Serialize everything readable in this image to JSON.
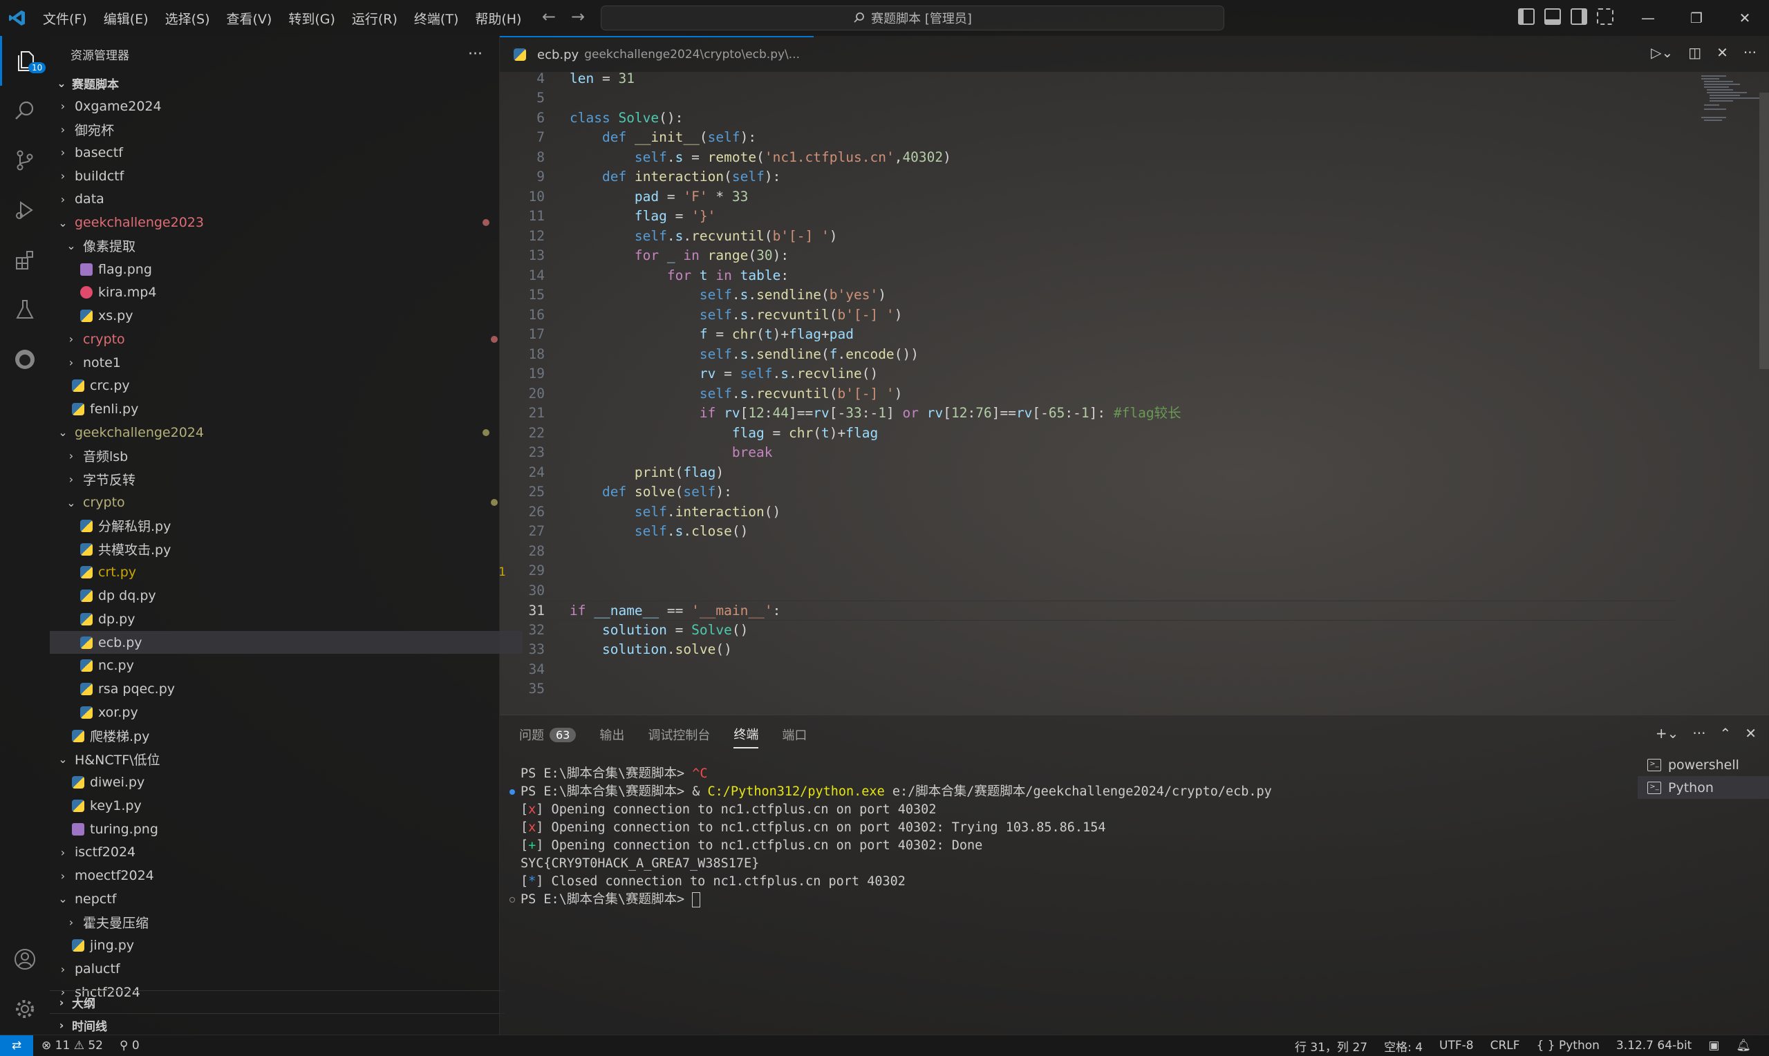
{
  "titlebar": {
    "menus": [
      "文件(F)",
      "编辑(E)",
      "选择(S)",
      "查看(V)",
      "转到(G)",
      "运行(R)",
      "终端(T)",
      "帮助(H)"
    ],
    "search_text": "赛题脚本 [管理员]"
  },
  "activity": {
    "explorer_badge": "10"
  },
  "sidebar": {
    "title": "资源管理器",
    "root": "赛题脚本",
    "outline": "大纲",
    "timeline": "时间线",
    "tree": [
      {
        "label": "0xgame2024"
      },
      {
        "label": "御宛杯"
      },
      {
        "label": "basectf"
      },
      {
        "label": "buildctf"
      },
      {
        "label": "data"
      },
      {
        "label": "geekchallenge2023"
      },
      {
        "label": "像素提取"
      },
      {
        "label": "flag.png"
      },
      {
        "label": "kira.mp4"
      },
      {
        "label": "xs.py"
      },
      {
        "label": "crypto"
      },
      {
        "label": "note1"
      },
      {
        "label": "crc.py"
      },
      {
        "label": "fenli.py"
      },
      {
        "label": "geekchallenge2024"
      },
      {
        "label": "音频lsb"
      },
      {
        "label": "字节反转"
      },
      {
        "label": "crypto"
      },
      {
        "label": "分解私钥.py"
      },
      {
        "label": "共模攻击.py"
      },
      {
        "label": "crt.py",
        "badge": "1"
      },
      {
        "label": "dp dq.py"
      },
      {
        "label": "dp.py"
      },
      {
        "label": "ecb.py"
      },
      {
        "label": "nc.py"
      },
      {
        "label": "rsa pqec.py"
      },
      {
        "label": "xor.py"
      },
      {
        "label": "爬楼梯.py"
      },
      {
        "label": "H&NCTF\\低位"
      },
      {
        "label": "diwei.py"
      },
      {
        "label": "key1.py"
      },
      {
        "label": "turing.png"
      },
      {
        "label": "isctf2024"
      },
      {
        "label": "moectf2024"
      },
      {
        "label": "nepctf"
      },
      {
        "label": "霍夫曼压缩"
      },
      {
        "label": "jing.py"
      },
      {
        "label": "paluctf"
      },
      {
        "label": "shctf2024"
      }
    ]
  },
  "tab": {
    "name": "ecb.py",
    "path": "geekchallenge2024\\crypto\\ecb.py\\..."
  },
  "code": [
    {
      "n": "4",
      "t": "len = 31"
    },
    {
      "n": "5",
      "t": ""
    },
    {
      "n": "6",
      "t": "class Solve():"
    },
    {
      "n": "7",
      "t": "    def __init__(self):"
    },
    {
      "n": "8",
      "t": "        self.s = remote('nc1.ctfplus.cn',40302)"
    },
    {
      "n": "9",
      "t": "    def interaction(self):"
    },
    {
      "n": "10",
      "t": "        pad = 'F' * 33"
    },
    {
      "n": "11",
      "t": "        flag = '}'"
    },
    {
      "n": "12",
      "t": "        self.s.recvuntil(b'[-] ')"
    },
    {
      "n": "13",
      "t": "        for _ in range(30):"
    },
    {
      "n": "14",
      "t": "            for t in table:"
    },
    {
      "n": "15",
      "t": "                self.s.sendline(b'yes')"
    },
    {
      "n": "16",
      "t": "                self.s.recvuntil(b'[-] ')"
    },
    {
      "n": "17",
      "t": "                f = chr(t)+flag+pad"
    },
    {
      "n": "18",
      "t": "                self.s.sendline(f.encode())"
    },
    {
      "n": "19",
      "t": "                rv = self.s.recvline()"
    },
    {
      "n": "20",
      "t": "                self.s.recvuntil(b'[-] ')"
    },
    {
      "n": "21",
      "t": "                if rv[12:44]==rv[-33:-1] or rv[12:76]==rv[-65:-1]: #flag较长"
    },
    {
      "n": "22",
      "t": "                    flag = chr(t)+flag"
    },
    {
      "n": "23",
      "t": "                    break"
    },
    {
      "n": "24",
      "t": "        print(flag)"
    },
    {
      "n": "25",
      "t": "    def solve(self):"
    },
    {
      "n": "26",
      "t": "        self.interaction()"
    },
    {
      "n": "27",
      "t": "        self.s.close()"
    },
    {
      "n": "28",
      "t": ""
    },
    {
      "n": "29",
      "t": ""
    },
    {
      "n": "30",
      "t": ""
    },
    {
      "n": "31",
      "t": "if __name__ == '__main__':"
    },
    {
      "n": "32",
      "t": "    solution = Solve()"
    },
    {
      "n": "33",
      "t": "    solution.solve()"
    },
    {
      "n": "34",
      "t": ""
    },
    {
      "n": "35",
      "t": ""
    }
  ],
  "panel": {
    "tabs": [
      "问题",
      "输出",
      "调试控制台",
      "终端",
      "端口"
    ],
    "problems_count": "63",
    "terminals": [
      "powershell",
      "Python"
    ],
    "terminal_lines": [
      "PS E:\\脚本合集\\赛题脚本> ^C",
      "PS E:\\脚本合集\\赛题脚本> & C:/Python312/python.exe e:/脚本合集/赛题脚本/geekchallenge2024/crypto/ecb.py",
      "[x] Opening connection to nc1.ctfplus.cn on port 40302",
      "[x] Opening connection to nc1.ctfplus.cn on port 40302: Trying 103.85.86.154",
      "[+] Opening connection to nc1.ctfplus.cn on port 40302: Done",
      "SYC{CRY9T0HACK_A_GREA7_W38S17E}",
      "[*] Closed connection to nc1.ctfplus.cn port 40302",
      "PS E:\\脚本合集\\赛题脚本> "
    ]
  },
  "status": {
    "errors": "11",
    "warnings": "52",
    "ports": "0",
    "position": "行 31，列 27",
    "spaces": "空格: 4",
    "encoding": "UTF-8",
    "eol": "CRLF",
    "language": "Python",
    "interpreter": "3.12.7 64-bit"
  },
  "colors": {
    "accent": "#0078d4",
    "modified_red": "#e06c75",
    "modified_olive": "#9e9a54"
  }
}
